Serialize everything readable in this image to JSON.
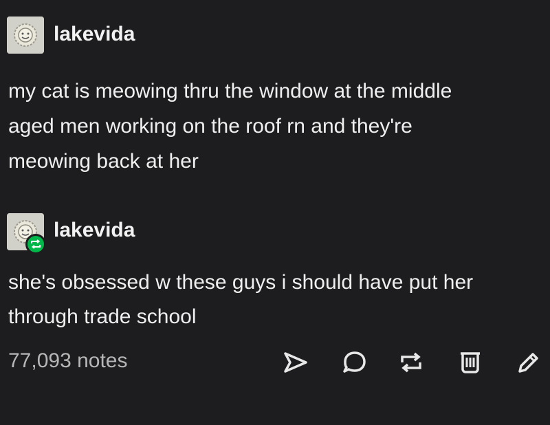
{
  "original_post": {
    "username": "lakevida",
    "avatar_icon": "sun-face-avatar-icon",
    "text_lines": [
      "my cat is meowing thru the window at the middle",
      "aged men working on the roof rn and they're",
      "meowing back at her"
    ]
  },
  "reblog": {
    "username": "lakevida",
    "avatar_icon": "sun-face-avatar-icon",
    "badge_icon": "reblog-icon",
    "text_lines": [
      "she's obsessed w these guys i should have put her",
      "through trade school"
    ]
  },
  "footer": {
    "notes": "77,093 notes",
    "actions": [
      "share-icon",
      "reply-icon",
      "reblog-icon",
      "delete-icon",
      "edit-icon"
    ]
  },
  "colors": {
    "background": "#1d1d1f",
    "text": "#efefef",
    "muted": "#b6b6b6",
    "reblog_green": "#00b84a"
  }
}
